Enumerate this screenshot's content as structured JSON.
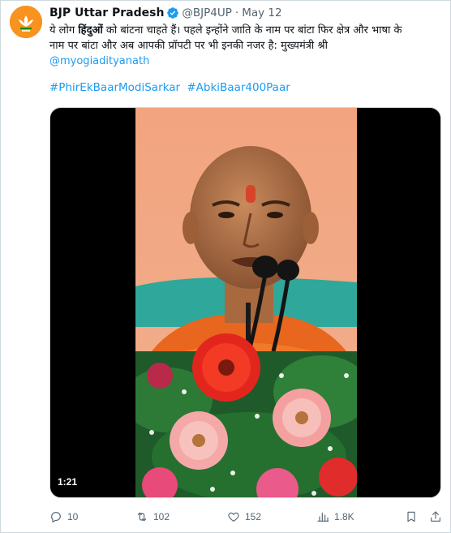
{
  "author": {
    "name": "BJP Uttar Pradesh",
    "handle": "@BJP4UP",
    "separator": "·",
    "date": "May 12"
  },
  "tweet": {
    "line1_a": "ये लोग ",
    "line1_bold": "हिंदुओं",
    "line1_b": " को बांटना चाहते हैं। पहले इन्होंने जाति के नाम पर बांटा फिर क्षेत्र और भाषा के",
    "line2": "नाम पर बांटा और अब आपकी प्रॉपटी पर भी इनकी नजर है: मुख्यमंत्री श्री",
    "mention": "@myogiadityanath",
    "hashtags": [
      "#PhirEkBaarModiSarkar",
      "#AbkiBaar400Paar"
    ]
  },
  "video": {
    "duration": "1:21"
  },
  "actions": {
    "replies": "10",
    "reposts": "102",
    "likes": "152",
    "views": "1.8K"
  },
  "colors": {
    "link": "#1d9bf0",
    "secondary_text": "#536471",
    "brand_orange": "#f47b20",
    "verified": "#1d9bf0"
  },
  "icons": [
    "verified-badge-icon",
    "reply-icon",
    "retweet-icon",
    "like-icon",
    "views-icon",
    "bookmark-icon",
    "share-icon"
  ]
}
